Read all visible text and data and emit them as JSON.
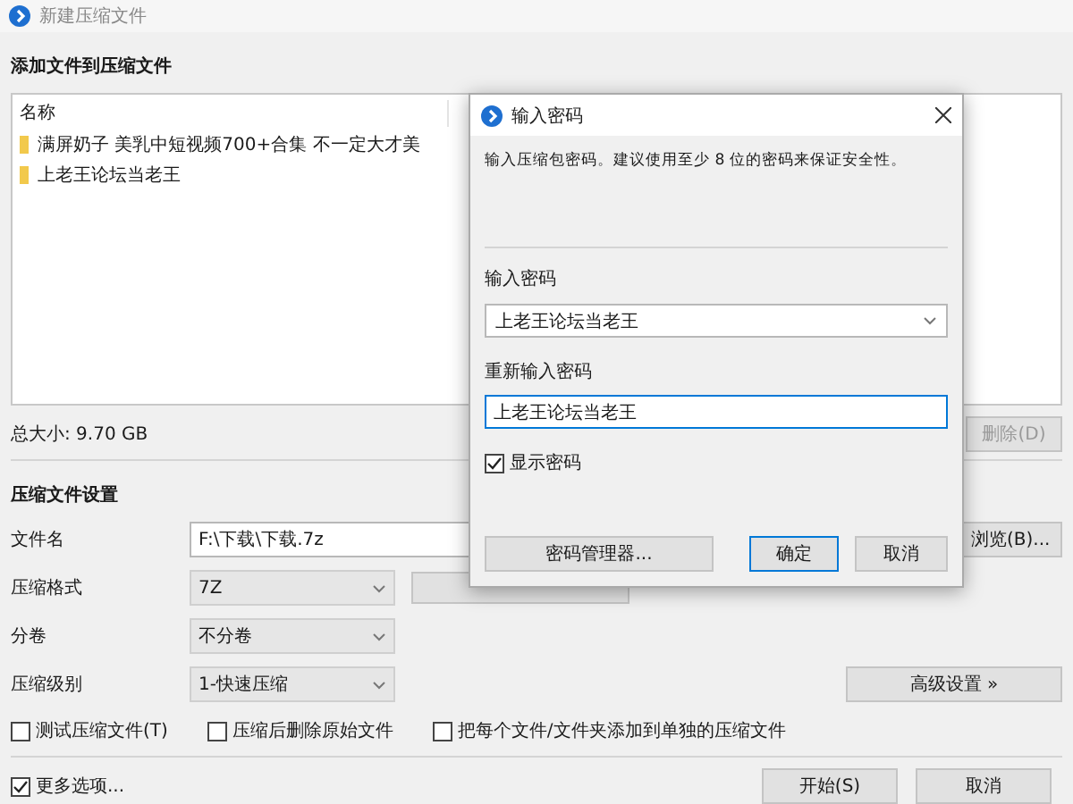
{
  "window": {
    "title": "新建压缩文件"
  },
  "add_section": {
    "heading": "添加文件到压缩文件",
    "column": "名称",
    "files": [
      {
        "name": "满屏奶子 美乳中短视频700+合集 不一定大才美",
        "selected": false
      },
      {
        "name": "上老王论坛当老王",
        "selected": false
      }
    ],
    "total": "总大小: 9.70 GB",
    "delete_button": {
      "label": "删除(D)",
      "disabled": true
    }
  },
  "settings": {
    "heading": "压缩文件设置",
    "filename": {
      "label": "文件名",
      "value": "F:\\下载\\下载.7z",
      "browse": "浏览(B)..."
    },
    "selects": [
      {
        "label": "压缩格式",
        "value": "7Z"
      },
      {
        "label": "分卷",
        "value": "不分卷"
      },
      {
        "label": "压缩级别",
        "value": "1-快速压缩"
      }
    ],
    "advanced_button": "高级设置 »",
    "options": [
      {
        "label": "测试压缩文件(T)",
        "checked": false
      },
      {
        "label": "压缩后删除原始文件",
        "checked": false
      },
      {
        "label": "把每个文件/文件夹添加到单独的压缩文件",
        "checked": false
      }
    ]
  },
  "footer": {
    "more_options": {
      "label": "更多选项...",
      "checked": true
    },
    "buttons": [
      {
        "label": "开始(S)",
        "default": false
      },
      {
        "label": "取消",
        "default": false
      }
    ]
  },
  "dialog": {
    "title": "输入密码",
    "message": "输入压缩包密码。建议使用至少 8 位的密码来保证安全性。",
    "password_label": "输入密码",
    "password_value": "上老王论坛当老王",
    "repeat_label": "重新输入密码",
    "repeat_value": "上老王论坛当老王",
    "show_password": {
      "label": "显示密码",
      "checked": true
    },
    "buttons": [
      {
        "label": "密码管理器...",
        "default": false
      },
      {
        "label": "确定",
        "default": true
      },
      {
        "label": "取消",
        "default": false
      }
    ]
  }
}
